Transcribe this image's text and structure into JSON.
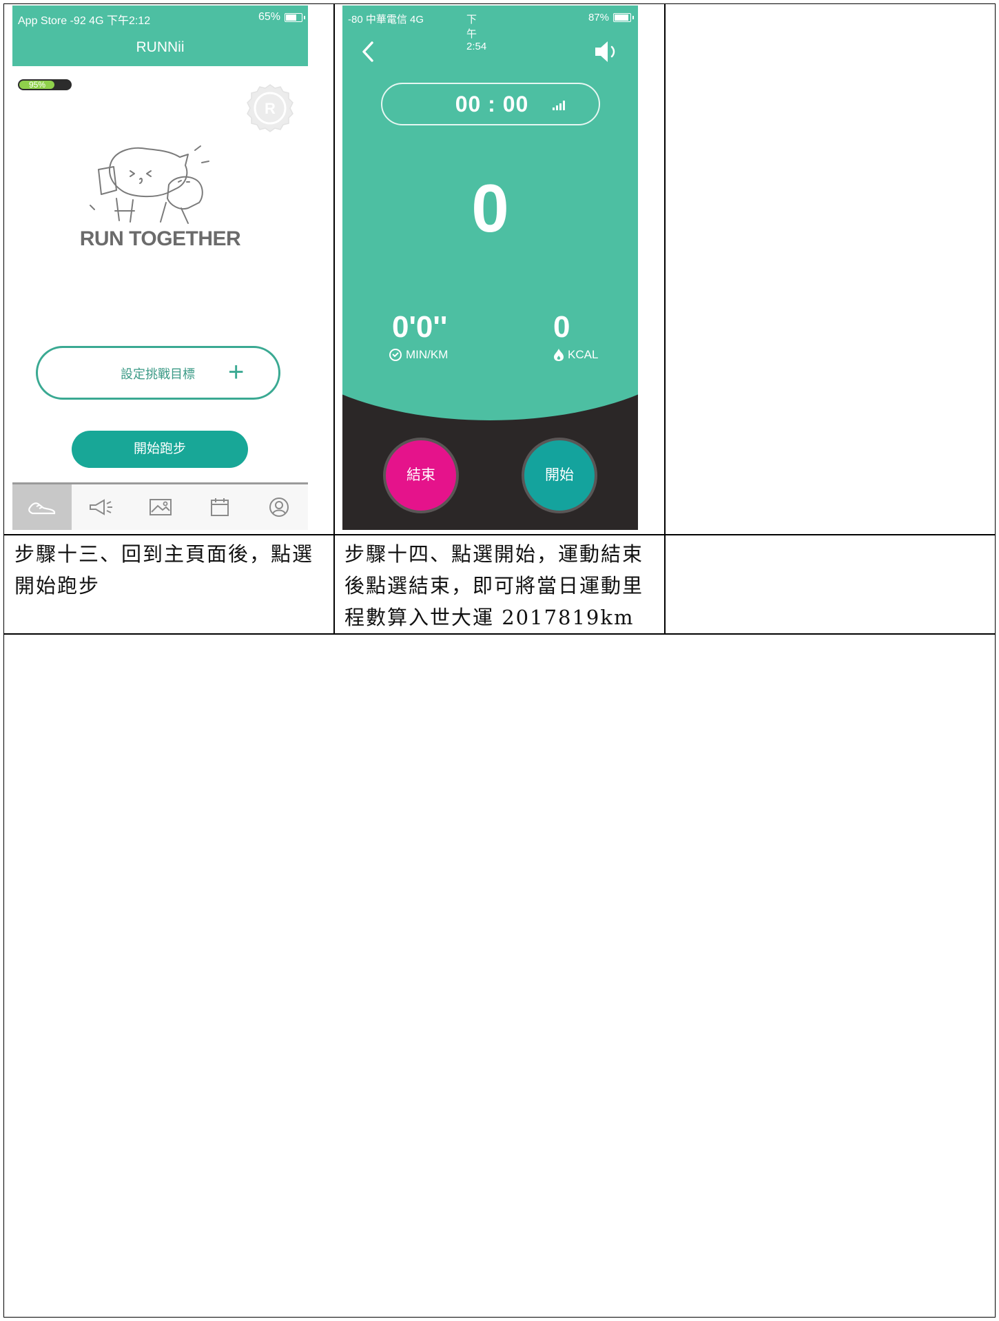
{
  "app": {
    "status_left": "App Store  -92  4G  下午2:12",
    "status_right": "65%",
    "title": "RUNNii",
    "battery_pill": "95%",
    "slogan": "RUN TOGETHER",
    "goal_button": "設定挑戰目標",
    "goal_plus": "+",
    "start_button": "開始跑步",
    "tabs": [
      "shoe-icon",
      "megaphone-icon",
      "image-icon",
      "calendar-icon",
      "profile-icon"
    ],
    "accent": "#4dbfa2"
  },
  "run_screen": {
    "status_left": "-80 中華電信  4G",
    "status_time": "下午2:54",
    "status_right": "87%",
    "timer": "00 : 00",
    "distance": "0",
    "pace": "0'0''",
    "pace_label": "MIN/KM",
    "kcal": "0",
    "kcal_label": "KCAL",
    "end_button": "結束",
    "start_button": "開始",
    "end_color": "#e5138b",
    "start_color": "#14a39d"
  },
  "captions": {
    "step13_line1": "步驟十三、回到主頁面後，點選",
    "step13_line2": "開始跑步",
    "step14_line1": "步驟十四、點選開始，運動結束",
    "step14_line2": "後點選結束，即可將當日運動里",
    "step14_line3": "程數算入世大運 2017819km"
  }
}
